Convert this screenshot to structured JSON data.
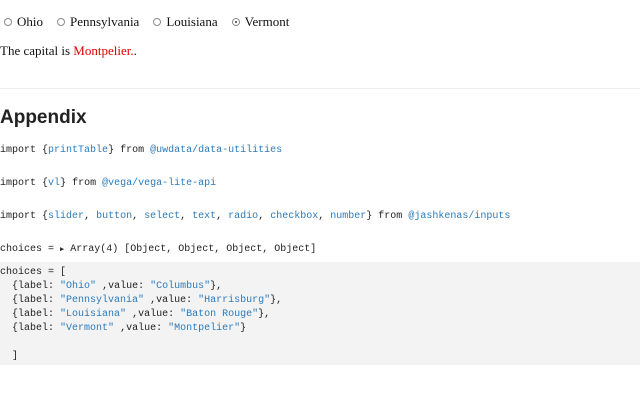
{
  "radios": [
    {
      "label": "Ohio",
      "checked": false
    },
    {
      "label": "Pennsylvania",
      "checked": false
    },
    {
      "label": "Louisiana",
      "checked": false
    },
    {
      "label": "Vermont",
      "checked": true
    }
  ],
  "capital": {
    "prefix": "The capital is ",
    "city": "Montpelier.",
    "suffix": "."
  },
  "appendix_title": "Appendix",
  "imports": [
    {
      "kw": "import",
      "open": "{",
      "names": [
        "printTable"
      ],
      "close": "}",
      "from": "from",
      "module": "@uwdata/data-utilities"
    },
    {
      "kw": "import",
      "open": "{",
      "names": [
        "vl"
      ],
      "close": "}",
      "from": "from",
      "module": "@vega/vega-lite-api"
    },
    {
      "kw": "import",
      "open": "{",
      "names": [
        "slider",
        "button",
        "select",
        "text",
        "radio",
        "checkbox",
        "number"
      ],
      "close": "}",
      "from": "from",
      "module": "@jashkenas/inputs"
    }
  ],
  "choices_summary": {
    "lhs": "choices = ",
    "arrow": "▶",
    "value": "Array(4) [Object, Object, Object, Object]"
  },
  "choices_cell": {
    "line1": "choices = [",
    "rows": [
      {
        "label": "Ohio",
        "value": "Columbus",
        "tail": "},"
      },
      {
        "label": "Pennsylvania",
        "value": "Harrisburg",
        "tail": "},"
      },
      {
        "label": "Louisiana",
        "value": "Baton Rouge",
        "tail": "},"
      },
      {
        "label": "Vermont",
        "value": "Montpelier",
        "tail": "}"
      }
    ],
    "close": "]"
  }
}
